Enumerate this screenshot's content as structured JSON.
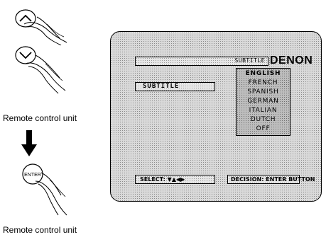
{
  "captions": {
    "remote_top": "Remote control unit",
    "remote_bottom": "Remote control unit"
  },
  "remote": {
    "enter_label": "ENTER"
  },
  "osd": {
    "title": "SUBTITLE",
    "brand": "DENON",
    "menu_label": "SUBTITLE",
    "languages": [
      "ENGLISH",
      "FRENCH",
      "SPANISH",
      "GERMAN",
      "ITALIAN",
      "DUTCH",
      "OFF"
    ],
    "selected_language": "ENGLISH",
    "select_hint": "SELECT: ▼▲◀▶",
    "decision_hint": "DECISION: ENTER BUTTON"
  },
  "icons": [
    "hand-press-up-icon",
    "hand-press-down-icon",
    "arrow-down-icon",
    "hand-press-enter-icon"
  ]
}
